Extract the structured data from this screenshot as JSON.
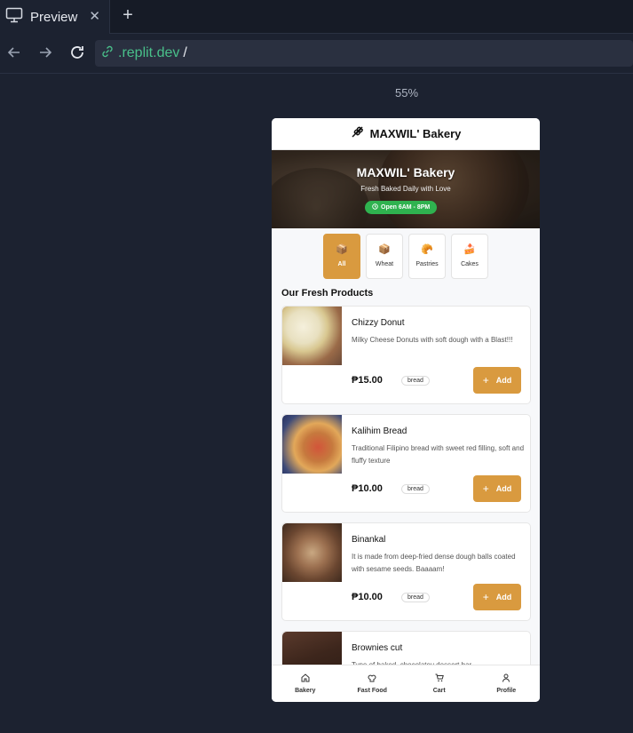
{
  "browser": {
    "tab_title": "Preview",
    "url_host": ".replit.dev",
    "url_path": "/",
    "zoom": "55%"
  },
  "app": {
    "header_title": "MAXWIL' Bakery",
    "hero": {
      "title": "MAXWIL' Bakery",
      "subtitle": "Fresh Baked Daily with Love",
      "hours": "Open 6AM - 8PM"
    },
    "categories": [
      {
        "label": "All",
        "icon": "box-icon",
        "active": true
      },
      {
        "label": "Wheat",
        "icon": "box-icon",
        "active": false
      },
      {
        "label": "Pastries",
        "icon": "croissant-icon",
        "active": false
      },
      {
        "label": "Cakes",
        "icon": "cake-icon",
        "active": false
      }
    ],
    "section_title": "Our Fresh Products",
    "products": [
      {
        "name": "Chizzy Donut",
        "desc": "Milky Cheese Donuts with soft dough with a Blast!!!",
        "price": "₱15.00",
        "tag": "bread",
        "add_label": "Add"
      },
      {
        "name": "Kalihim Bread",
        "desc": "Traditional Filipino bread with sweet red filling, soft and fluffy texture",
        "price": "₱10.00",
        "tag": "bread",
        "add_label": "Add"
      },
      {
        "name": "Binankal",
        "desc": "It is made from deep-fried dense dough balls coated with sesame seeds. Baaaam!",
        "price": "₱10.00",
        "tag": "bread",
        "add_label": "Add"
      },
      {
        "name": "Brownies cut",
        "desc": "Type of baked, chocolatey dessert bar",
        "price": "",
        "tag": "",
        "add_label": ""
      }
    ],
    "bottom_nav": [
      {
        "label": "Bakery",
        "icon": "home-icon"
      },
      {
        "label": "Fast Food",
        "icon": "chef-hat-icon"
      },
      {
        "label": "Cart",
        "icon": "cart-icon"
      },
      {
        "label": "Profile",
        "icon": "user-icon"
      }
    ]
  },
  "colors": {
    "accent": "#d99a3f",
    "open_badge": "#2fb24f",
    "url_green": "#49c08a",
    "background": "#1c2230"
  }
}
